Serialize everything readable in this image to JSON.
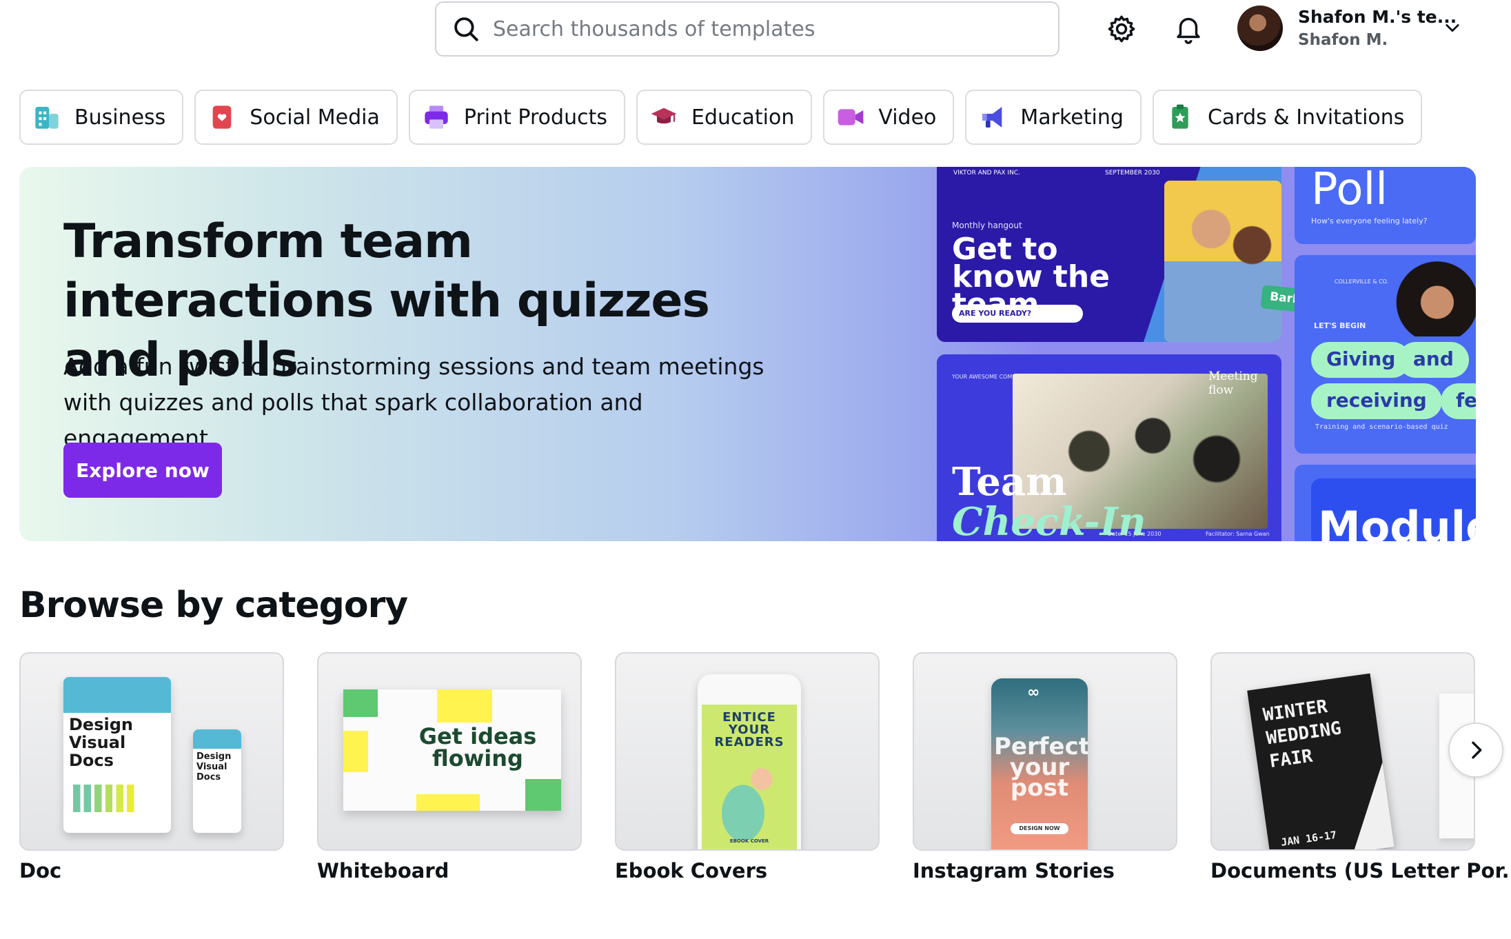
{
  "search": {
    "placeholder": "Search thousands of templates"
  },
  "account": {
    "team_name": "Shafon M.'s te...",
    "user_name": "Shafon M."
  },
  "categories": [
    {
      "label": "Business",
      "icon": "business-icon",
      "color": "#3bb5c4"
    },
    {
      "label": "Social Media",
      "icon": "social-media-icon",
      "color": "#e2454f"
    },
    {
      "label": "Print Products",
      "icon": "printer-icon",
      "color": "#7d2ae8"
    },
    {
      "label": "Education",
      "icon": "graduation-cap-icon",
      "color": "#b8325a"
    },
    {
      "label": "Video",
      "icon": "video-camera-icon",
      "color": "#c85ee0"
    },
    {
      "label": "Marketing",
      "icon": "megaphone-icon",
      "color": "#4a4ee0"
    },
    {
      "label": "Cards & Invitations",
      "icon": "card-icon",
      "color": "#2f9d5a"
    }
  ],
  "hero": {
    "title": "Transform team interactions with quizzes and polls",
    "description": "Add a fun twist to brainstorming sessions and team meetings with quizzes and polls that spark collaboration and engagement.",
    "cta": "Explore now",
    "tiles": {
      "t1_company": "VIKTOR AND PAX INC.",
      "t1_date": "SEPTEMBER 2030",
      "t1_kicker": "Monthly hangout",
      "t1_title": "Get to know the team",
      "t1_pill": "ARE YOU READY?",
      "t1_tag": "Barbara",
      "t2_company": "YOUR AWESOME COMPANY",
      "t2_flow": "Meeting flow",
      "t2_title_1": "Team",
      "t2_title_2": "Check-In",
      "t2_date": "Date: 15 June 2030",
      "t2_facilitator": "Facilitator: Sarna Gwan",
      "t3_title": "Poll",
      "t3_question": "How's everyone feeling lately?",
      "t4_company": "COLLERVILLE & CO.",
      "t4_lead": "LET'S BEGIN",
      "t4_word1": "Giving",
      "t4_word2": "and",
      "t4_word3": "receiving",
      "t4_word4": "fee",
      "t4_caption": "Training and scenario-based quiz",
      "t5_title": "Module"
    },
    "accent": "#7d2ae8"
  },
  "browse": {
    "title": "Browse by category",
    "cards": [
      {
        "label": "Doc",
        "art": "Design Visual Docs"
      },
      {
        "label": "Whiteboard",
        "art": "Get ideas flowing"
      },
      {
        "label": "Ebook Covers",
        "art": "ENTICE YOUR READERS",
        "art_sub": "EBOOK COVER"
      },
      {
        "label": "Instagram Stories",
        "art": "Perfect your post",
        "art_btn": "DESIGN NOW"
      },
      {
        "label": "Documents (US Letter Por...",
        "art": "WINTER WEDDING FAIR",
        "art_date": "JAN 16-17"
      }
    ],
    "next_icon": "chevron-right-icon"
  }
}
